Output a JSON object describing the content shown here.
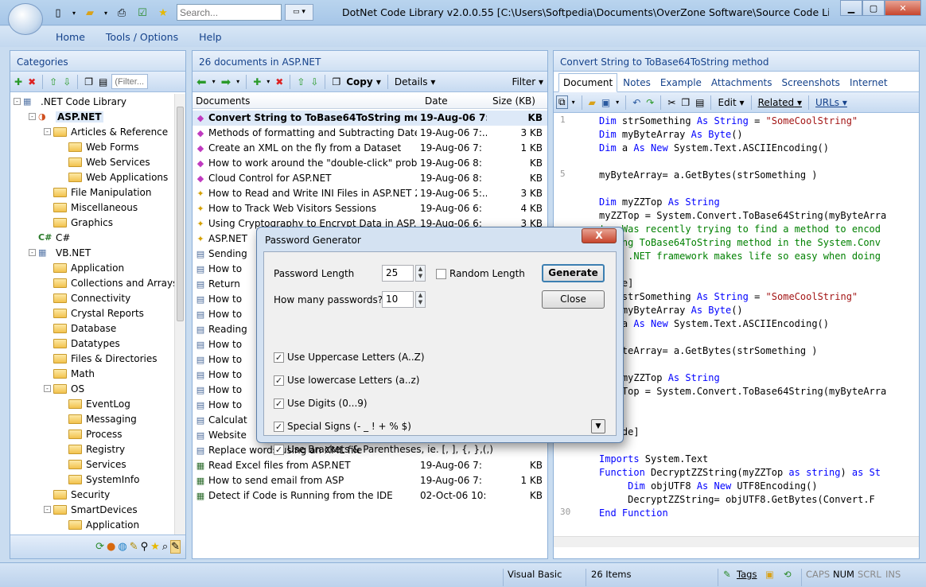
{
  "title": {
    "search_placeholder": "Search...",
    "window_title": "DotNet Code Library v2.0.0.55 [C:\\Users\\Softpedia\\Documents\\OverZone Software\\Source Code Library v2\\data\\Li..."
  },
  "menu": [
    "Home",
    "Tools / Options",
    "Help"
  ],
  "categories": {
    "header": "Categories",
    "filter_placeholder": "(Filter...",
    "tree": [
      {
        "label": ".NET Code Library",
        "level": 0,
        "exp": "-",
        "icon": "lib"
      },
      {
        "label": "ASP.NET",
        "level": 1,
        "exp": "-",
        "icon": "asp",
        "sel": true
      },
      {
        "label": "Articles & Reference",
        "level": 2,
        "exp": "-",
        "icon": "folder"
      },
      {
        "label": "Web Forms",
        "level": 3,
        "icon": "folder"
      },
      {
        "label": "Web Services",
        "level": 3,
        "icon": "folder"
      },
      {
        "label": "Web Applications",
        "level": 3,
        "icon": "folder"
      },
      {
        "label": "File Manipulation",
        "level": 2,
        "icon": "folder"
      },
      {
        "label": "Miscellaneous",
        "level": 2,
        "icon": "folder"
      },
      {
        "label": "Graphics",
        "level": 2,
        "icon": "folder"
      },
      {
        "label": "C#",
        "level": 1,
        "icon": "cs"
      },
      {
        "label": "VB.NET",
        "level": 1,
        "exp": "-",
        "icon": "vb"
      },
      {
        "label": "Application",
        "level": 2,
        "icon": "folder"
      },
      {
        "label": "Collections and Arrays",
        "level": 2,
        "icon": "folder"
      },
      {
        "label": "Connectivity",
        "level": 2,
        "icon": "folder"
      },
      {
        "label": "Crystal Reports",
        "level": 2,
        "icon": "folder"
      },
      {
        "label": "Database",
        "level": 2,
        "icon": "folder"
      },
      {
        "label": "Datatypes",
        "level": 2,
        "icon": "folder"
      },
      {
        "label": "Files & Directories",
        "level": 2,
        "icon": "folder"
      },
      {
        "label": "Math",
        "level": 2,
        "icon": "folder"
      },
      {
        "label": "OS",
        "level": 2,
        "exp": "-",
        "icon": "folder"
      },
      {
        "label": "EventLog",
        "level": 3,
        "icon": "folder"
      },
      {
        "label": "Messaging",
        "level": 3,
        "icon": "folder"
      },
      {
        "label": "Process",
        "level": 3,
        "icon": "folder"
      },
      {
        "label": "Registry",
        "level": 3,
        "icon": "folder"
      },
      {
        "label": "Services",
        "level": 3,
        "icon": "folder"
      },
      {
        "label": "SystemInfo",
        "level": 3,
        "icon": "folder"
      },
      {
        "label": "Security",
        "level": 2,
        "icon": "folder"
      },
      {
        "label": "SmartDevices",
        "level": 2,
        "exp": "-",
        "icon": "folder"
      },
      {
        "label": "Application",
        "level": 3,
        "icon": "folder"
      }
    ]
  },
  "documents": {
    "header": "26 documents in ASP.NET",
    "copy_label": "Copy",
    "details_label": "Details",
    "filter_label": "Filter",
    "columns": [
      "Documents",
      "Date",
      "Size (KB)"
    ],
    "rows": [
      {
        "name": "Convert String to ToBase64ToString method",
        "date": "19-Aug-06 7:",
        "size": "KB",
        "sel": true,
        "icon": "gem"
      },
      {
        "name": "Methods of formatting and Subtracting Date...",
        "date": "19-Aug-06 7:...",
        "size": "3 KB",
        "icon": "gem"
      },
      {
        "name": "Create an XML on the fly from a Dataset",
        "date": "19-Aug-06 7:",
        "size": "1 KB",
        "icon": "gem"
      },
      {
        "name": "How to work around the \"double-click\" prob",
        "date": "19-Aug-06 8:",
        "size": "KB",
        "icon": "gem"
      },
      {
        "name": "Cloud Control for ASP.NET",
        "date": "19-Aug-06 8:",
        "size": "KB",
        "icon": "gem"
      },
      {
        "name": "How to Read and Write INI Files in ASP.NET 2.0",
        "date": "19-Aug-06 5:...",
        "size": "3 KB",
        "icon": "star"
      },
      {
        "name": "How to Track Web Visitors Sessions",
        "date": "19-Aug-06 6:",
        "size": "4 KB",
        "icon": "star"
      },
      {
        "name": "Using Cryptography to Encrypt Data in ASP.",
        "date": "19-Aug-06 6:",
        "size": "3 KB",
        "icon": "star"
      },
      {
        "name": "ASP.NET",
        "date": "",
        "size": "",
        "icon": "star"
      },
      {
        "name": "Sending",
        "date": "",
        "size": "",
        "icon": "doc"
      },
      {
        "name": "How to",
        "date": "",
        "size": "",
        "icon": "doc"
      },
      {
        "name": "Return",
        "date": "",
        "size": "",
        "icon": "doc"
      },
      {
        "name": "How to",
        "date": "",
        "size": "",
        "icon": "doc"
      },
      {
        "name": "How to",
        "date": "",
        "size": "",
        "icon": "doc"
      },
      {
        "name": "Reading",
        "date": "",
        "size": "",
        "icon": "doc"
      },
      {
        "name": "How to",
        "date": "",
        "size": "",
        "icon": "doc"
      },
      {
        "name": "How to",
        "date": "",
        "size": "",
        "icon": "doc"
      },
      {
        "name": "How to",
        "date": "",
        "size": "",
        "icon": "doc"
      },
      {
        "name": "How to",
        "date": "",
        "size": "",
        "icon": "doc"
      },
      {
        "name": "How to",
        "date": "",
        "size": "",
        "icon": "doc"
      },
      {
        "name": "Calculat",
        "date": "",
        "size": "",
        "icon": "doc"
      },
      {
        "name": "Website",
        "date": "",
        "size": "",
        "icon": "doc"
      },
      {
        "name": "Replace words using an XML file",
        "date": "",
        "size": "",
        "icon": "doc"
      },
      {
        "name": "Read Excel files from ASP.NET",
        "date": "19-Aug-06 7:",
        "size": "KB",
        "icon": "sheet"
      },
      {
        "name": "How to send email from ASP",
        "date": "19-Aug-06 7:",
        "size": "1 KB",
        "icon": "sheet"
      },
      {
        "name": "Detect if Code is Running from the IDE",
        "date": "02-Oct-06 10:",
        "size": "KB",
        "icon": "sheet"
      }
    ]
  },
  "editor": {
    "header": "Convert String to ToBase64ToString method",
    "tabs": [
      "Document",
      "Notes",
      "Example",
      "Attachments",
      "Screenshots",
      "Internet"
    ],
    "edit_label": "Edit",
    "related_label": "Related",
    "urls_label": "URLs",
    "gutter": [
      "1",
      "",
      "",
      "",
      "5",
      "",
      "",
      "",
      "",
      "",
      "",
      "",
      "",
      "",
      "",
      "",
      "",
      "",
      "",
      "",
      "",
      "",
      "",
      "",
      "",
      "",
      "",
      "",
      "",
      "30"
    ],
    "lines": [
      [
        [
          "kw",
          "Dim "
        ],
        [
          "",
          "strSomething "
        ],
        [
          "kw",
          "As String"
        ],
        [
          "",
          " = "
        ],
        [
          "str",
          "\"SomeCoolString\""
        ]
      ],
      [
        [
          "kw",
          "Dim "
        ],
        [
          "",
          "myByteArray "
        ],
        [
          "kw",
          "As Byte"
        ],
        [
          "",
          "()"
        ]
      ],
      [
        [
          "kw",
          "Dim "
        ],
        [
          "",
          "a "
        ],
        [
          "kw",
          "As New "
        ],
        [
          "",
          "System.Text.ASCIIEncoding()"
        ]
      ],
      [
        [
          "",
          ""
        ]
      ],
      [
        [
          "",
          "myByteArray= a.GetBytes(strSomething )"
        ]
      ],
      [
        [
          "",
          ""
        ]
      ],
      [
        [
          "kw",
          "Dim "
        ],
        [
          "",
          "myZZTop "
        ],
        [
          "kw",
          "As String"
        ]
      ],
      [
        [
          "",
          "myZZTop = System.Convert.ToBase64String(myByteArra"
        ]
      ],
      [
        [
          "cm",
          "'...Was recently trying to find a method to encod"
        ]
      ],
      [
        [
          "cm",
          "'using ToBase64ToString method in the System.Conv"
        ]
      ],
      [
        [
          "cm",
          "'the .NET framework makes life so easy when doing"
        ]
      ],
      [
        [
          "",
          ""
        ]
      ],
      [
        [
          "",
          "[Code]"
        ]
      ],
      [
        [
          "kw",
          "Dim "
        ],
        [
          "",
          "strSomething "
        ],
        [
          "kw",
          "As String"
        ],
        [
          "",
          " = "
        ],
        [
          "str",
          "\"SomeCoolString\""
        ]
      ],
      [
        [
          "kw",
          "Dim "
        ],
        [
          "",
          "myByteArray "
        ],
        [
          "kw",
          "As Byte"
        ],
        [
          "",
          "()"
        ]
      ],
      [
        [
          "kw",
          "Dim "
        ],
        [
          "",
          "a "
        ],
        [
          "kw",
          "As New "
        ],
        [
          "",
          "System.Text.ASCIIEncoding()"
        ]
      ],
      [
        [
          "",
          ""
        ]
      ],
      [
        [
          "",
          "myByteArray= a.GetBytes(strSomething )"
        ]
      ],
      [
        [
          "",
          ""
        ]
      ],
      [
        [
          "kw",
          "Dim "
        ],
        [
          "",
          "myZZTop "
        ],
        [
          "kw",
          "As String"
        ]
      ],
      [
        [
          "",
          "myZZTop = System.Convert.ToBase64String(myByteArra"
        ]
      ],
      [
        [
          "",
          ""
        ]
      ],
      [
        [
          "",
          ""
        ]
      ],
      [
        [
          "",
          "[/Code]"
        ]
      ],
      [
        [
          "",
          ""
        ]
      ],
      [
        [
          "kw",
          "Imports "
        ],
        [
          "",
          "System.Text"
        ]
      ],
      [
        [
          "kw",
          "Function "
        ],
        [
          "",
          "DecryptZZString(myZZTop "
        ],
        [
          "kw",
          "as string"
        ],
        [
          "",
          ") "
        ],
        [
          "kw",
          "as St"
        ]
      ],
      [
        [
          "",
          "     "
        ],
        [
          "kw",
          "Dim "
        ],
        [
          "",
          "objUTF8 "
        ],
        [
          "kw",
          "As New "
        ],
        [
          "",
          "UTF8Encoding()"
        ]
      ],
      [
        [
          "",
          "     DecryptZZString= objUTF8.GetBytes(Convert.F"
        ]
      ],
      [
        [
          "kw",
          "End Function"
        ]
      ]
    ]
  },
  "status": {
    "language": "Visual Basic",
    "items": "26 Items",
    "tags": "Tags",
    "caps": "CAPS",
    "num": "NUM",
    "scrl": "SCRL",
    "ins": "INS"
  },
  "dialog": {
    "title": "Password Generator",
    "close_x": "X",
    "pw_length_label": "Password Length",
    "pw_length": "25",
    "count_label": "How many passwords?",
    "count": "10",
    "random_label": "Random Length",
    "generate": "Generate",
    "close": "Close",
    "options": [
      "Use Uppercase Letters (A..Z)",
      "Use lowercase Letters (a..z)",
      "Use Digits (0...9)",
      "Special Signs (- _ ! + % $)",
      "Use Brackets & Parentheses, ie. [, ], {, },(,)"
    ]
  }
}
